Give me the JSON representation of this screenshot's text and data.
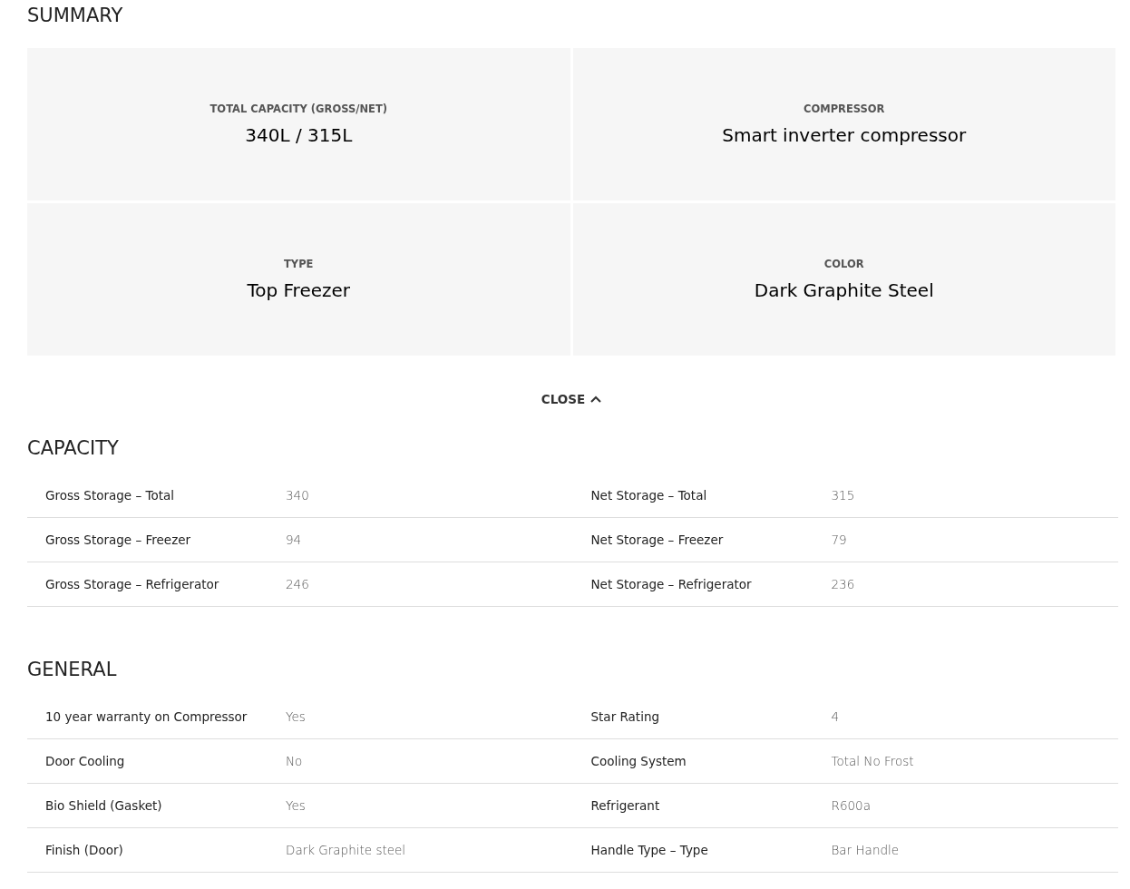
{
  "summary": {
    "title": "SUMMARY",
    "cards": [
      {
        "label": "TOTAL CAPACITY (GROSS/NET)",
        "value": "340L / 315L"
      },
      {
        "label": "COMPRESSOR",
        "value": "Smart inverter compressor"
      },
      {
        "label": "TYPE",
        "value": "Top Freezer"
      },
      {
        "label": "COLOR",
        "value": "Dark Graphite Steel"
      }
    ],
    "close_button": "CLOSE"
  },
  "sections": [
    {
      "title": "CAPACITY",
      "items": [
        {
          "label": "Gross Storage – Total",
          "value": "340"
        },
        {
          "label": "Net Storage – Total",
          "value": "315"
        },
        {
          "label": "Gross Storage – Freezer",
          "value": "94"
        },
        {
          "label": "Net Storage – Freezer",
          "value": "79"
        },
        {
          "label": "Gross Storage – Refrigerator",
          "value": "246"
        },
        {
          "label": "Net Storage – Refrigerator",
          "value": "236"
        }
      ]
    },
    {
      "title": "GENERAL",
      "items": [
        {
          "label": "10 year warranty on Compressor",
          "value": "Yes"
        },
        {
          "label": "Star Rating",
          "value": "4"
        },
        {
          "label": "Door Cooling",
          "value": "No"
        },
        {
          "label": "Cooling System",
          "value": "Total No Frost"
        },
        {
          "label": "Bio Shield (Gasket)",
          "value": "Yes"
        },
        {
          "label": "Refrigerant",
          "value": "R600a"
        },
        {
          "label": "Finish (Door)",
          "value": "Dark Graphite steel"
        },
        {
          "label": "Handle Type – Type",
          "value": "Bar Handle"
        }
      ]
    }
  ]
}
